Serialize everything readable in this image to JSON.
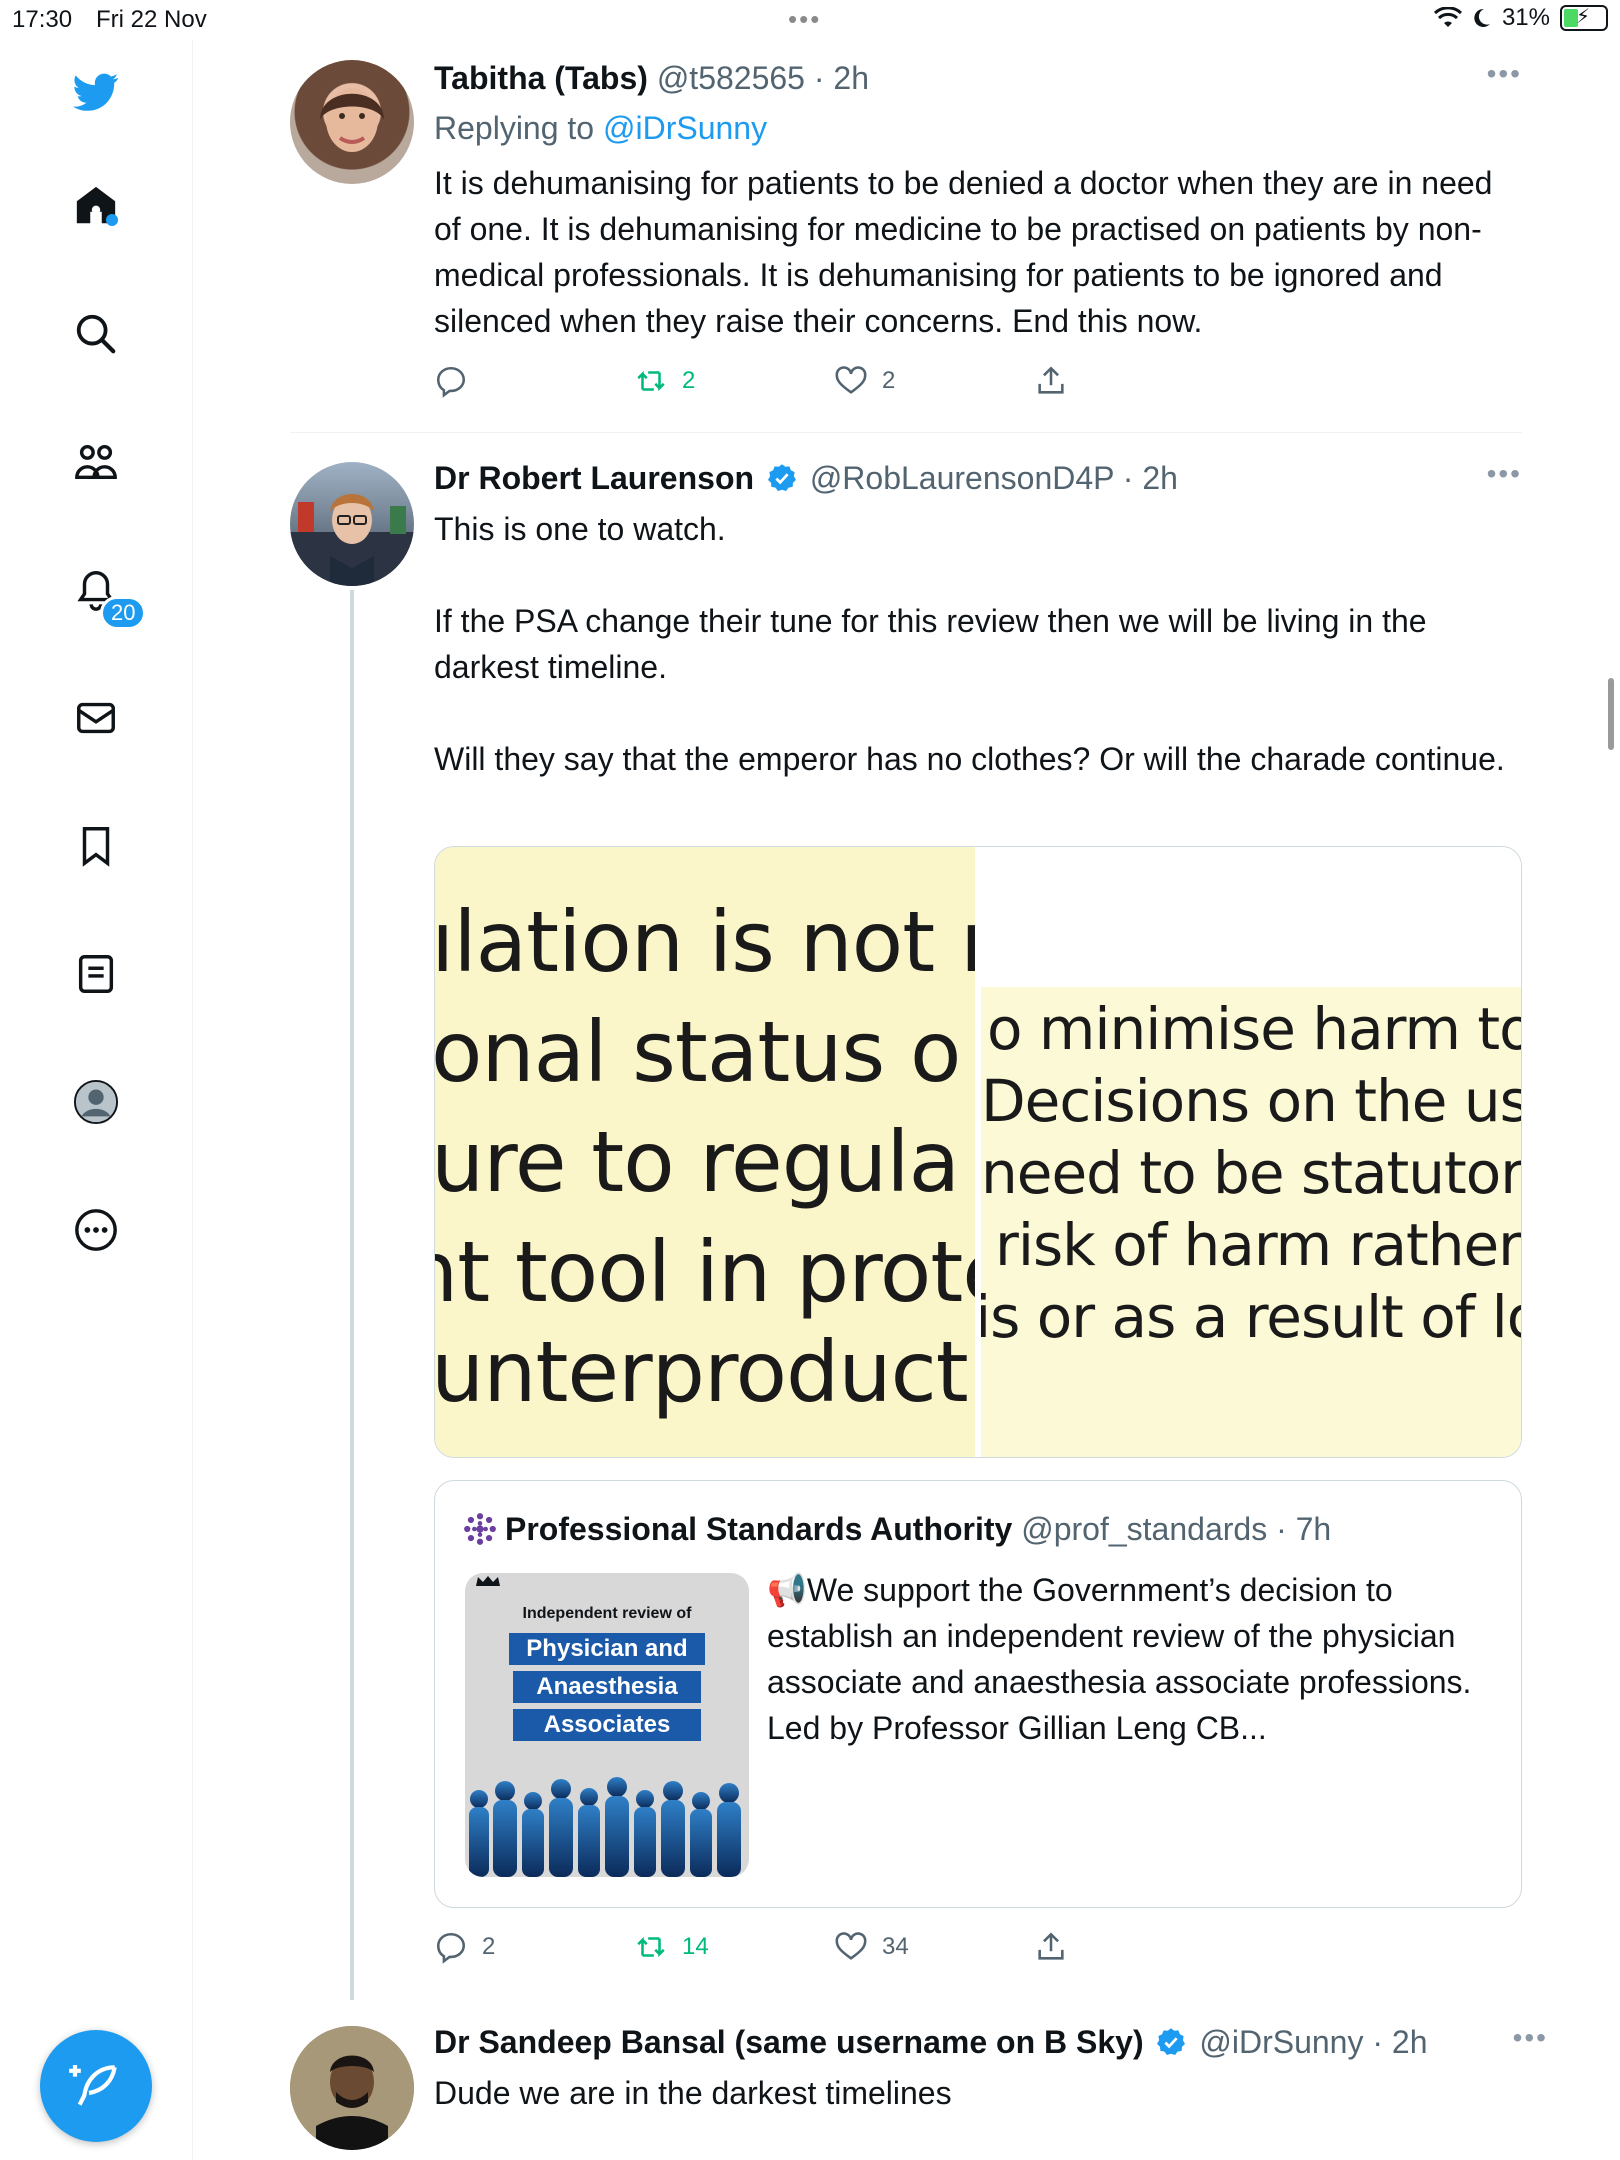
{
  "status_bar": {
    "time": "17:30",
    "date": "Fri 22 Nov",
    "battery": "31%"
  },
  "sidebar": {
    "notifications_badge": "20",
    "items": [
      "twitter-logo",
      "home",
      "explore",
      "communities",
      "notifications",
      "messages",
      "bookmarks",
      "lists",
      "profile",
      "more"
    ]
  },
  "tweets": [
    {
      "name": "Tabitha (Tabs)",
      "handle": "@t582565",
      "time": "2h",
      "replying_prefix": "Replying to",
      "replying_to": "@iDrSunny",
      "text": "It is dehumanising for patients to be denied a doctor when they are in need of one. It is dehumanising for medicine to be practised on patients by non-medical professionals. It is dehumanising for patients to be ignored and silenced when they raise their concerns. End this now.",
      "replies": "",
      "retweets": "2",
      "likes": "2"
    },
    {
      "name": "Dr Robert Laurenson",
      "handle": "@RobLaurensonD4P",
      "time": "2h",
      "paragraphs": [
        "This is one to watch.",
        "If the PSA change their tune for this review then we will be living in the darkest timeline.",
        "Will they say that the emperor has no clothes? Or will the charade continue."
      ],
      "image_left_lines": [
        "ılation is not ı",
        "onal status o",
        "ure to regula",
        "nt tool in prote",
        "unterproducti"
      ],
      "image_right_lines": [
        "o minimise harm to",
        "Decisions on the use",
        "need to be statutorily",
        "risk of harm rather t",
        "is or as a result of lo"
      ],
      "quote": {
        "name": "Professional Standards Authority",
        "handle": "@prof_standards",
        "time": "7h",
        "text": "📢We support the Government’s decision to establish an independent review of the physician associate and anaesthesia associate professions. Led by Professor Gillian Leng CB...",
        "thumb_title": "Independent review of",
        "thumb_lines": [
          "Physician and",
          "Anaesthesia",
          "Associates"
        ]
      },
      "replies": "2",
      "retweets": "14",
      "likes": "34"
    },
    {
      "name": "Dr Sandeep Bansal (same username on B Sky)",
      "handle": "@iDrSunny",
      "time": "2h",
      "text": "Dude we are in the darkest timelines"
    }
  ],
  "colors": {
    "accent": "#1d9bf0",
    "retweet": "#00ba7c",
    "muted": "#536471"
  }
}
